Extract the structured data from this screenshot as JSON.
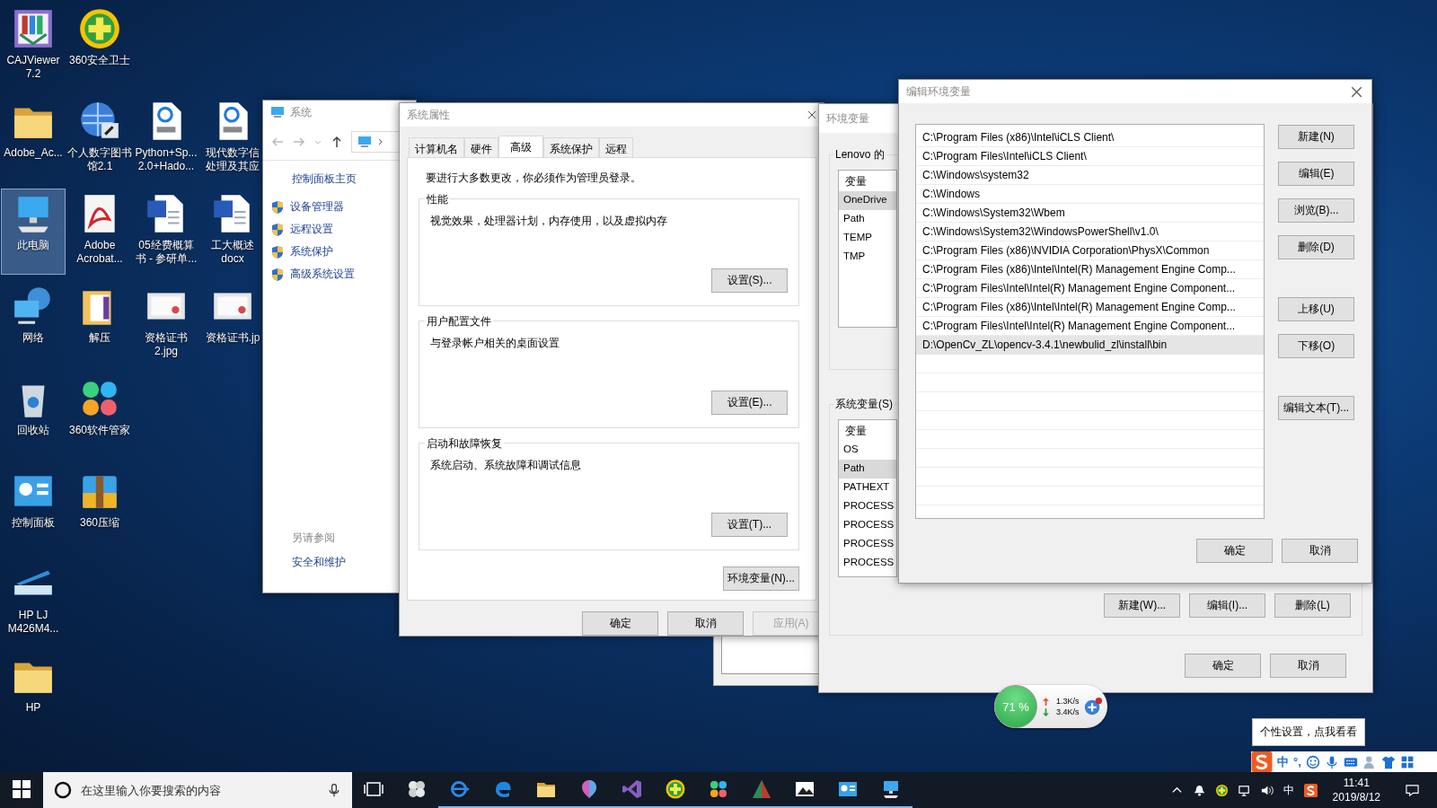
{
  "desktop": {
    "columns": [
      [
        {
          "label": "CAJViewer\n7.2",
          "kind": "book",
          "selected": false
        },
        {
          "label": "Adobe_Ac...",
          "kind": "folder",
          "selected": false
        },
        {
          "label": "此电脑",
          "kind": "computer",
          "selected": true
        },
        {
          "label": "网络",
          "kind": "network",
          "selected": false
        },
        {
          "label": "回收站",
          "kind": "recycle",
          "selected": false
        },
        {
          "label": "控制面板",
          "kind": "control",
          "selected": false
        },
        {
          "label": "HP LJ\nM426M4...",
          "kind": "scanner",
          "selected": false
        },
        {
          "label": "HP",
          "kind": "folder",
          "selected": false
        }
      ],
      [
        {
          "label": "360安全卫士",
          "kind": "plus",
          "selected": false
        },
        {
          "label": "个人数字图书馆2.1",
          "kind": "globe",
          "selected": false
        },
        {
          "label": "Adobe\nAcrobat...",
          "kind": "acrobat",
          "selected": false
        },
        {
          "label": "解压",
          "kind": "archivefolder",
          "selected": false
        },
        {
          "label": "360软件管家",
          "kind": "flower",
          "selected": false
        },
        {
          "label": "360压缩",
          "kind": "zip",
          "selected": false
        }
      ],
      [
        {
          "label": "Python+Sp...\n2.0+Hado...",
          "kind": "pdf",
          "selected": false
        },
        {
          "label": "05经费概算书 - 参研单...",
          "kind": "word",
          "selected": false
        },
        {
          "label": "资格证书\n2.jpg",
          "kind": "certificate",
          "selected": false
        }
      ],
      [
        {
          "label": "现代数字信处理及其应",
          "kind": "pdf",
          "selected": false
        },
        {
          "label": "工大概述\ndocx",
          "kind": "word",
          "selected": false
        },
        {
          "label": "资格证书.jp",
          "kind": "certificate",
          "selected": false
        }
      ]
    ]
  },
  "system_window": {
    "title": "系统",
    "home_link": "控制面板主页",
    "tasks": [
      "设备管理器",
      "远程设置",
      "系统保护",
      "高级系统设置"
    ],
    "see_also_title": "另请参阅",
    "see_also": [
      "安全和维护"
    ]
  },
  "system_properties": {
    "title": "系统属性",
    "tabs": [
      {
        "label": "计算机名",
        "selected": false
      },
      {
        "label": "硬件",
        "selected": false
      },
      {
        "label": "高级",
        "selected": true
      },
      {
        "label": "系统保护",
        "selected": false
      },
      {
        "label": "远程",
        "selected": false
      }
    ],
    "notice": "要进行大多数更改，你必须作为管理员登录。",
    "groups": [
      {
        "title": "性能",
        "description": "视觉效果，处理器计划，内存使用，以及虚拟内存",
        "button": "设置(S)..."
      },
      {
        "title": "用户配置文件",
        "description": "与登录帐户相关的桌面设置",
        "button": "设置(E)..."
      },
      {
        "title": "启动和故障恢复",
        "description": "系统启动、系统故障和调试信息",
        "button": "设置(T)..."
      }
    ],
    "env_button": "环境变量(N)...",
    "buttons": [
      {
        "label": "确定",
        "disabled": false
      },
      {
        "label": "取消",
        "disabled": false
      },
      {
        "label": "应用(A)",
        "disabled": true
      }
    ]
  },
  "environment_variables": {
    "title": "环境变量",
    "user_group_title": "Lenovo 的",
    "user_header": "变量",
    "user_vars": [
      {
        "name": "OneDrive",
        "selected": true
      },
      {
        "name": "Path",
        "selected": false
      },
      {
        "name": "TEMP",
        "selected": false
      },
      {
        "name": "TMP",
        "selected": false
      }
    ],
    "system_group_title": "系统变量(S)",
    "system_header": "变量",
    "system_vars": [
      {
        "name": "OS",
        "selected": false
      },
      {
        "name": "Path",
        "selected": true
      },
      {
        "name": "PATHEXT",
        "selected": false
      },
      {
        "name": "PROCESS",
        "selected": false
      },
      {
        "name": "PROCESS",
        "selected": false
      },
      {
        "name": "PROCESS",
        "selected": false
      },
      {
        "name": "PROCESS",
        "selected": false
      }
    ],
    "system_buttons": [
      "新建(W)...",
      "编辑(I)...",
      "删除(L)"
    ],
    "buttons": [
      "确定",
      "取消"
    ]
  },
  "edit_variable": {
    "title": "编辑环境变量",
    "paths": [
      {
        "text": "C:\\Program Files (x86)\\Intel\\iCLS Client\\",
        "selected": false
      },
      {
        "text": "C:\\Program Files\\Intel\\iCLS Client\\",
        "selected": false
      },
      {
        "text": "C:\\Windows\\system32",
        "selected": false
      },
      {
        "text": "C:\\Windows",
        "selected": false
      },
      {
        "text": "C:\\Windows\\System32\\Wbem",
        "selected": false
      },
      {
        "text": "C:\\Windows\\System32\\WindowsPowerShell\\v1.0\\",
        "selected": false
      },
      {
        "text": "C:\\Program Files (x86)\\NVIDIA Corporation\\PhysX\\Common",
        "selected": false
      },
      {
        "text": "C:\\Program Files (x86)\\Intel\\Intel(R) Management Engine Comp...",
        "selected": false
      },
      {
        "text": "C:\\Program Files\\Intel\\Intel(R) Management Engine Component...",
        "selected": false
      },
      {
        "text": "C:\\Program Files (x86)\\Intel\\Intel(R) Management Engine Comp...",
        "selected": false
      },
      {
        "text": "C:\\Program Files\\Intel\\Intel(R) Management Engine Component...",
        "selected": false
      },
      {
        "text": "D:\\OpenCv_ZL\\opencv-3.4.1\\newbulid_zl\\install\\bin",
        "selected": true
      }
    ],
    "button_groups": [
      [
        "新建(N)",
        "编辑(E)",
        "浏览(B)...",
        "删除(D)"
      ],
      [
        "上移(U)",
        "下移(O)"
      ],
      [
        "编辑文本(T)..."
      ]
    ],
    "buttons": [
      "确定",
      "取消"
    ]
  },
  "net_widget": {
    "memory": "71 %",
    "upload": "1.3K/s",
    "download": "3.4K/s"
  },
  "tooltip": "个性设置，点我看看",
  "ime_bar": {
    "mode": "中",
    "punctuation": "°,"
  },
  "taskbar": {
    "search_placeholder": "在这里输入你要搜索的内容",
    "apps": [
      {
        "kind": "pinwheel",
        "running": false
      },
      {
        "kind": "ie",
        "running": true
      },
      {
        "kind": "edge",
        "running": true
      },
      {
        "kind": "folder",
        "running": true
      },
      {
        "kind": "balloon",
        "running": true
      },
      {
        "kind": "loop",
        "running": true
      },
      {
        "kind": "plus",
        "running": true
      },
      {
        "kind": "flower",
        "running": true
      },
      {
        "kind": "triangle",
        "running": true
      },
      {
        "kind": "image",
        "running": true
      },
      {
        "kind": "control",
        "running": true
      },
      {
        "kind": "computer",
        "running": true
      }
    ],
    "input_mode": "中",
    "time": "11:41",
    "date": "2019/8/12"
  }
}
